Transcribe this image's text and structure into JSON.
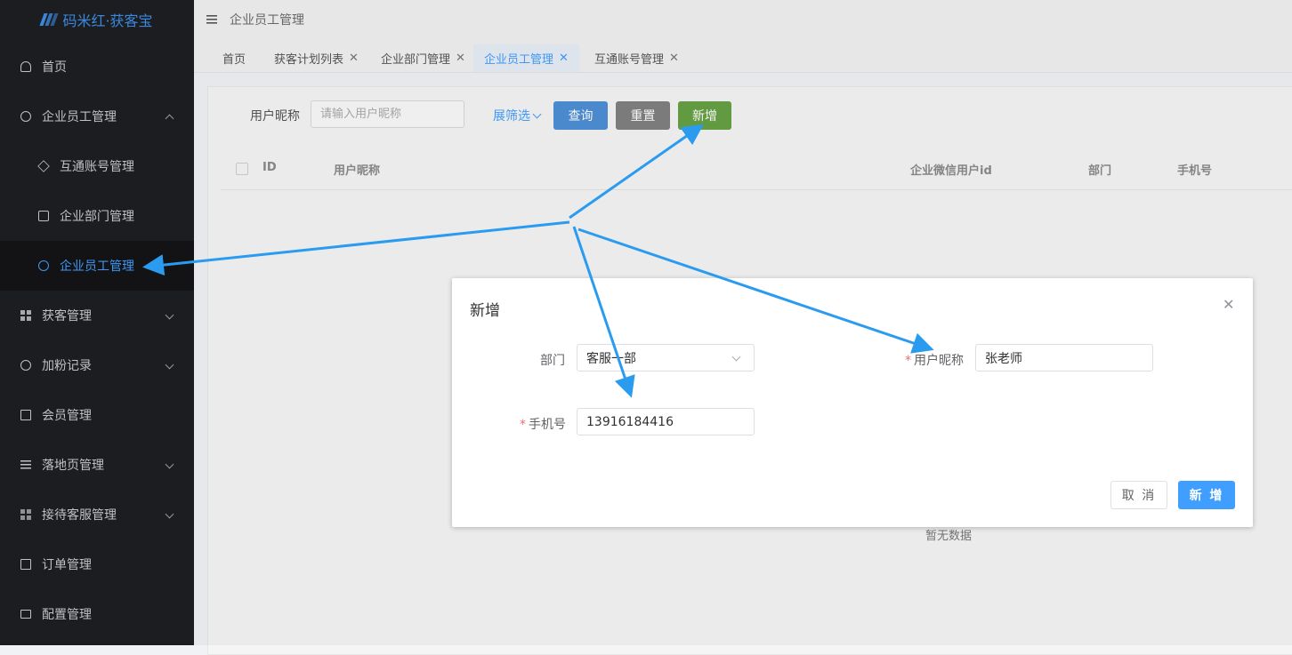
{
  "app": {
    "logo_text": "码米红·获客宝"
  },
  "header": {
    "title": "企业员工管理"
  },
  "sidebar": {
    "items": [
      {
        "label": "首页",
        "icon": "dashboard-icon"
      },
      {
        "label": "企业员工管理",
        "icon": "user-icon",
        "expanded": true
      },
      {
        "label": "互通账号管理",
        "icon": "cube-icon"
      },
      {
        "label": "企业部门管理",
        "icon": "puzzle-icon"
      },
      {
        "label": "企业员工管理",
        "icon": "user-icon",
        "active": true
      },
      {
        "label": "获客管理",
        "icon": "grid-icon"
      },
      {
        "label": "加粉记录",
        "icon": "compass-icon"
      },
      {
        "label": "会员管理",
        "icon": "card-icon"
      },
      {
        "label": "落地页管理",
        "icon": "list-icon"
      },
      {
        "label": "接待客服管理",
        "icon": "org-chart-icon"
      },
      {
        "label": "订单管理",
        "icon": "document-icon"
      },
      {
        "label": "配置管理",
        "icon": "monitor-icon"
      }
    ]
  },
  "tabs": [
    {
      "label": "首页",
      "closable": false
    },
    {
      "label": "获客计划列表",
      "closable": true
    },
    {
      "label": "企业部门管理",
      "closable": true
    },
    {
      "label": "企业员工管理",
      "closable": true,
      "active": true
    },
    {
      "label": "互通账号管理",
      "closable": true
    }
  ],
  "filter": {
    "nickname_label": "用户昵称",
    "nickname_placeholder": "请输入用户昵称",
    "expand_label": "展筛选",
    "query_label": "查询",
    "reset_label": "重置",
    "add_label": "新增"
  },
  "table": {
    "columns": [
      "ID",
      "用户昵称",
      "企业微信用户id",
      "部门",
      "手机号"
    ],
    "empty_text": "暂无数据"
  },
  "dialog": {
    "title": "新增",
    "department_label": "部门",
    "department_value": "客服一部",
    "nickname_label": "用户昵称",
    "nickname_value": "张老师",
    "phone_label": "手机号",
    "phone_value": "13916184416",
    "required_mark": "*",
    "cancel_label": "取 消",
    "submit_label": "新 增"
  },
  "colors": {
    "primary": "#409eff",
    "sidebar_bg": "#1e1f22",
    "add_button": "#67a144",
    "query_button": "#4f8fd6",
    "reset_button": "#808080",
    "annotation_arrow": "#2b9bf0",
    "required": "#f56c6c"
  }
}
